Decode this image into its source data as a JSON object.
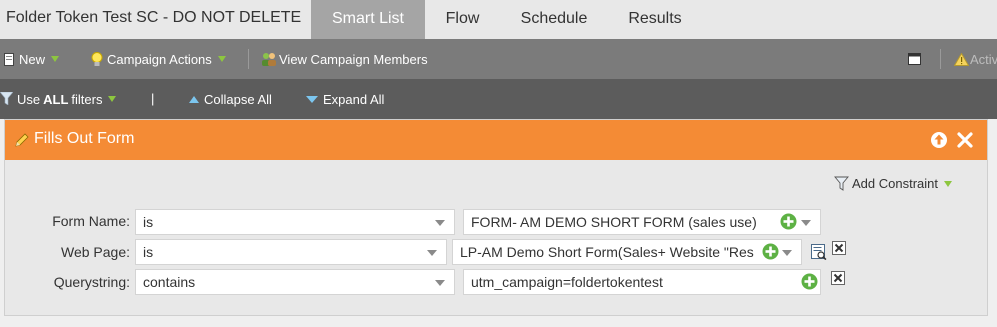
{
  "campaign": {
    "title": "Folder Token Test SC - DO NOT DELETE"
  },
  "tabs": [
    {
      "label": "Smart List",
      "active": true
    },
    {
      "label": "Flow",
      "active": false
    },
    {
      "label": "Schedule",
      "active": false
    },
    {
      "label": "Results",
      "active": false
    }
  ],
  "toolbar": {
    "new_label": "New",
    "campaign_actions_label": "Campaign Actions",
    "view_members_label": "View Campaign Members",
    "activation_label": "Activ"
  },
  "filterbar": {
    "use_prefix": "Use",
    "use_all": "ALL",
    "use_suffix": "filters",
    "separator": "|",
    "collapse_label": "Collapse All",
    "expand_label": "Expand All"
  },
  "filter": {
    "title": "Fills Out Form",
    "add_constraint_label": "Add Constraint",
    "rows": [
      {
        "label": "Form Name:",
        "operator": "is",
        "value": "FORM- AM DEMO SHORT FORM (sales use)"
      },
      {
        "label": "Web Page:",
        "operator": "is",
        "value": "LP-AM Demo Short Form(Sales+ Website \"Res"
      },
      {
        "label": "Querystring:",
        "operator": "contains",
        "value": "utm_campaign=foldertokentest"
      }
    ]
  },
  "colors": {
    "header_orange": "#f48b35",
    "toolbar_gray": "#7b7b7b",
    "filterbar_gray": "#5c5c5c",
    "active_tab": "#a5a5a5",
    "add_green": "#5db144",
    "expand_blue": "#7cc6ef"
  },
  "icons": {
    "new": "new-document-icon",
    "campaign_actions": "lightbulb-icon",
    "view_members": "people-icon",
    "window": "window-icon",
    "activation": "warning-icon",
    "use_filters": "funnel-icon",
    "collapse": "triangle-up-icon",
    "expand": "triangle-down-icon",
    "filter": "pencil-icon",
    "move_up": "arrow-up-circle-icon",
    "close": "close-icon",
    "add_constraint": "funnel-icon",
    "add_value": "plus-circle-icon",
    "lookup": "lookup-icon",
    "delete_row": "delete-icon"
  }
}
